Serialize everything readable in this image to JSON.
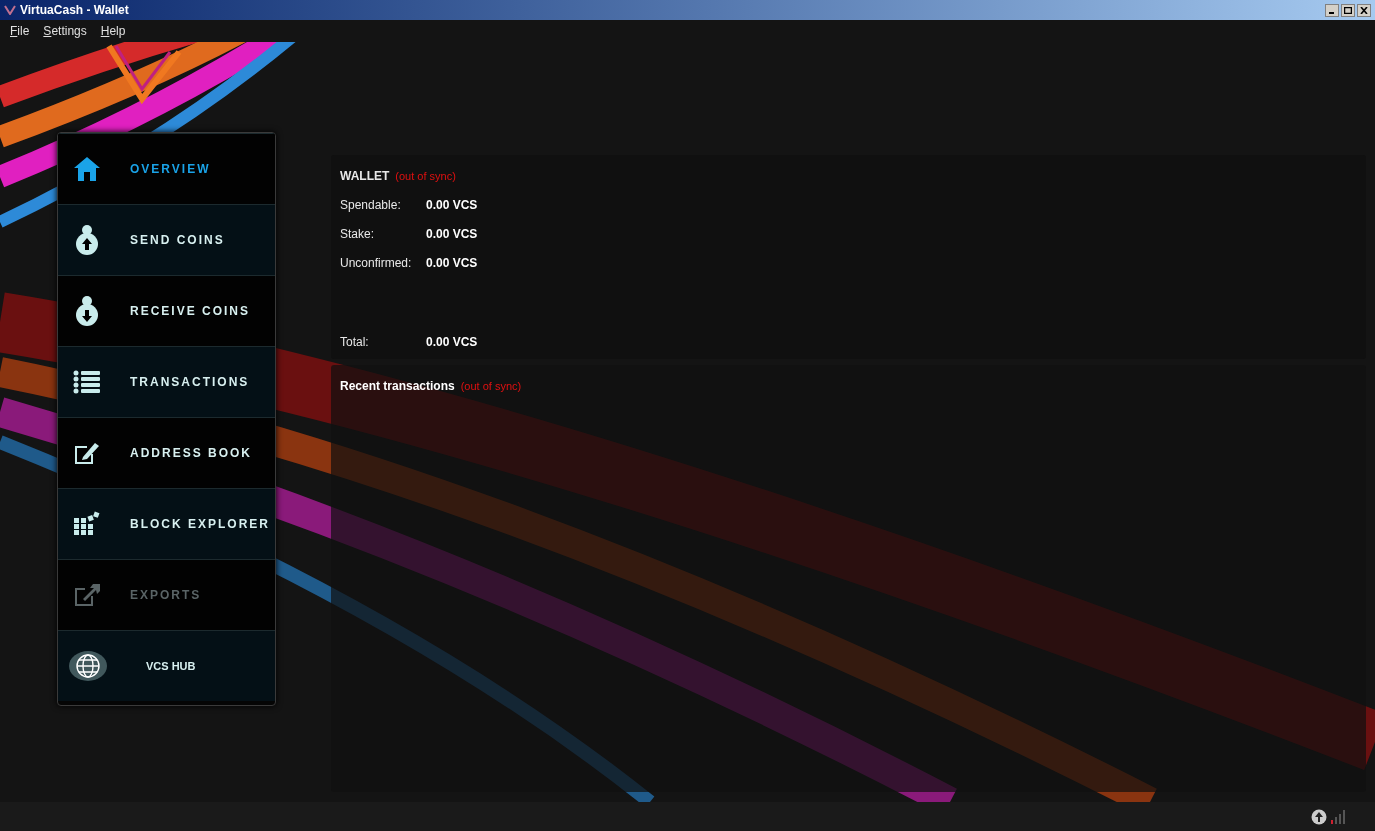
{
  "window": {
    "title": "VirtuaCash - Wallet"
  },
  "menu": [
    {
      "label": "File"
    },
    {
      "label": "Settings"
    },
    {
      "label": "Help"
    }
  ],
  "nav": [
    {
      "kind": "nav",
      "label": "OVERVIEW",
      "selected": true,
      "disabled": false
    },
    {
      "kind": "nav",
      "label": "SEND COINS",
      "selected": false,
      "disabled": false
    },
    {
      "kind": "nav",
      "label": "RECEIVE COINS",
      "selected": false,
      "disabled": false
    },
    {
      "kind": "nav",
      "label": "TRANSACTIONS",
      "selected": false,
      "disabled": false
    },
    {
      "kind": "nav",
      "label": "ADDRESS BOOK",
      "selected": false,
      "disabled": false
    },
    {
      "kind": "nav",
      "label": "BLOCK EXPLORER",
      "selected": false,
      "disabled": false
    },
    {
      "kind": "nav",
      "label": "EXPORTS",
      "selected": false,
      "disabled": true
    },
    {
      "kind": "hub",
      "label": "VCS HUB",
      "selected": false,
      "disabled": false
    }
  ],
  "wallet": {
    "title": "WALLET",
    "status": "(out of sync)",
    "rows": [
      {
        "label": "Spendable:",
        "value": "0.00 VCS"
      },
      {
        "label": "Stake:",
        "value": "0.00 VCS"
      },
      {
        "label": "Unconfirmed:",
        "value": "0.00 VCS"
      }
    ],
    "total": {
      "label": "Total:",
      "value": "0.00 VCS"
    }
  },
  "recent": {
    "title": "Recent transactions",
    "status": "(out of sync)"
  }
}
